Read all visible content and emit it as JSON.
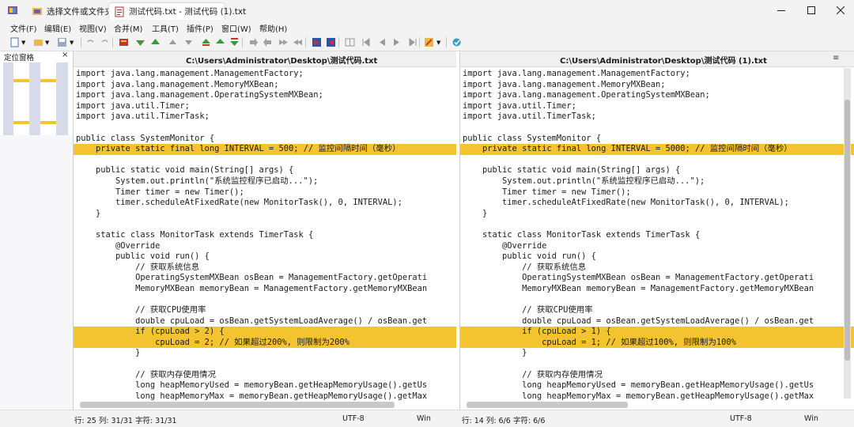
{
  "tabs": [
    {
      "label": "选择文件或文件夹",
      "icon": "folder-compare-icon"
    },
    {
      "label": "测试代码.txt - 测试代码 (1).txt",
      "icon": "text-compare-icon"
    }
  ],
  "menu": [
    "文件(F)",
    "编辑(E)",
    "视图(V)",
    "合并(M)",
    "工具(T)",
    "插件(P)",
    "窗口(W)",
    "帮助(H)"
  ],
  "locator": {
    "title": "定位窗格",
    "close": "×"
  },
  "left_pane": {
    "path": "C:\\Users\\Administrator\\Desktop\\测试代码.txt",
    "menu_glyph": "≡",
    "lines": [
      {
        "text": "import java.lang.management.ManagementFactory;",
        "diff": false
      },
      {
        "text": "import java.lang.management.MemoryMXBean;",
        "diff": false
      },
      {
        "text": "import java.lang.management.OperatingSystemMXBean;",
        "diff": false
      },
      {
        "text": "import java.util.Timer;",
        "diff": false
      },
      {
        "text": "import java.util.TimerTask;",
        "diff": false
      },
      {
        "text": "",
        "diff": false
      },
      {
        "text": "public class SystemMonitor {",
        "diff": false
      },
      {
        "text": "    private static final long INTERVAL = 500; // 监控间隔时间（毫秒）",
        "diff": true
      },
      {
        "text": "",
        "diff": false
      },
      {
        "text": "    public static void main(String[] args) {",
        "diff": false
      },
      {
        "text": "        System.out.println(\"系统监控程序已启动...\");",
        "diff": false
      },
      {
        "text": "        Timer timer = new Timer();",
        "diff": false
      },
      {
        "text": "        timer.scheduleAtFixedRate(new MonitorTask(), 0, INTERVAL);",
        "diff": false
      },
      {
        "text": "    }",
        "diff": false
      },
      {
        "text": "",
        "diff": false
      },
      {
        "text": "    static class MonitorTask extends TimerTask {",
        "diff": false
      },
      {
        "text": "        @Override",
        "diff": false
      },
      {
        "text": "        public void run() {",
        "diff": false
      },
      {
        "text": "            // 获取系统信息",
        "diff": false
      },
      {
        "text": "            OperatingSystemMXBean osBean = ManagementFactory.getOperati",
        "diff": false
      },
      {
        "text": "            MemoryMXBean memoryBean = ManagementFactory.getMemoryMXBean",
        "diff": false
      },
      {
        "text": "",
        "diff": false
      },
      {
        "text": "            // 获取CPU使用率",
        "diff": false
      },
      {
        "text": "            double cpuLoad = osBean.getSystemLoadAverage() / osBean.get",
        "diff": false
      },
      {
        "text": "            if (cpuLoad > 2) {",
        "diff": true
      },
      {
        "text": "                cpuLoad = 2; // 如果超过200%, 则限制为200%",
        "diff": true
      },
      {
        "text": "            }",
        "diff": false
      },
      {
        "text": "",
        "diff": false
      },
      {
        "text": "            // 获取内存使用情况",
        "diff": false
      },
      {
        "text": "            long heapMemoryUsed = memoryBean.getHeapMemoryUsage().getUs",
        "diff": false
      },
      {
        "text": "            long heapMemoryMax = memoryBean.getHeapMemoryUsage().getMax",
        "diff": false
      }
    ]
  },
  "right_pane": {
    "path": "C:\\Users\\Administrator\\Desktop\\测试代码 (1).txt",
    "menu_glyph": "≡",
    "lines": [
      {
        "text": "import java.lang.management.ManagementFactory;",
        "diff": false
      },
      {
        "text": "import java.lang.management.MemoryMXBean;",
        "diff": false
      },
      {
        "text": "import java.lang.management.OperatingSystemMXBean;",
        "diff": false
      },
      {
        "text": "import java.util.Timer;",
        "diff": false
      },
      {
        "text": "import java.util.TimerTask;",
        "diff": false
      },
      {
        "text": "",
        "diff": false
      },
      {
        "text": "public class SystemMonitor {",
        "diff": false
      },
      {
        "text": "    private static final long INTERVAL = 5000; // 监控间隔时间（毫秒）",
        "diff": true
      },
      {
        "text": "",
        "diff": false
      },
      {
        "text": "    public static void main(String[] args) {",
        "diff": false
      },
      {
        "text": "        System.out.println(\"系统监控程序已启动...\");",
        "diff": false
      },
      {
        "text": "        Timer timer = new Timer();",
        "diff": false
      },
      {
        "text": "        timer.scheduleAtFixedRate(new MonitorTask(), 0, INTERVAL);",
        "diff": false
      },
      {
        "text": "    }",
        "diff": false
      },
      {
        "text": "",
        "diff": false
      },
      {
        "text": "    static class MonitorTask extends TimerTask {",
        "diff": false
      },
      {
        "text": "        @Override",
        "diff": false
      },
      {
        "text": "        public void run() {",
        "diff": false
      },
      {
        "text": "            // 获取系统信息",
        "diff": false
      },
      {
        "text": "            OperatingSystemMXBean osBean = ManagementFactory.getOperati",
        "diff": false
      },
      {
        "text": "            MemoryMXBean memoryBean = ManagementFactory.getMemoryMXBean",
        "diff": false
      },
      {
        "text": "",
        "diff": false
      },
      {
        "text": "            // 获取CPU使用率",
        "diff": false
      },
      {
        "text": "            double cpuLoad = osBean.getSystemLoadAverage() / osBean.get",
        "diff": false
      },
      {
        "text": "            if (cpuLoad > 1) {",
        "diff": true
      },
      {
        "text": "                cpuLoad = 1; // 如果超过100%, 则限制为100%",
        "diff": true
      },
      {
        "text": "            }",
        "diff": false
      },
      {
        "text": "",
        "diff": false
      },
      {
        "text": "            // 获取内存使用情况",
        "diff": false
      },
      {
        "text": "            long heapMemoryUsed = memoryBean.getHeapMemoryUsage().getUs",
        "diff": false
      },
      {
        "text": "            long heapMemoryMax = memoryBean.getHeapMemoryUsage().getMax",
        "diff": false
      }
    ]
  },
  "status": {
    "left": {
      "position": "行: 25  列: 31/31  字符: 31/31",
      "encoding": "UTF-8",
      "eol": "Win"
    },
    "right": {
      "position": "行: 14  列: 6/6  字符: 6/6",
      "encoding": "UTF-8",
      "eol": "Win"
    }
  },
  "colors": {
    "diff_highlight": "#f4c430",
    "chrome": "#f3f3f3",
    "locator_bg": "#d7dbe9"
  }
}
